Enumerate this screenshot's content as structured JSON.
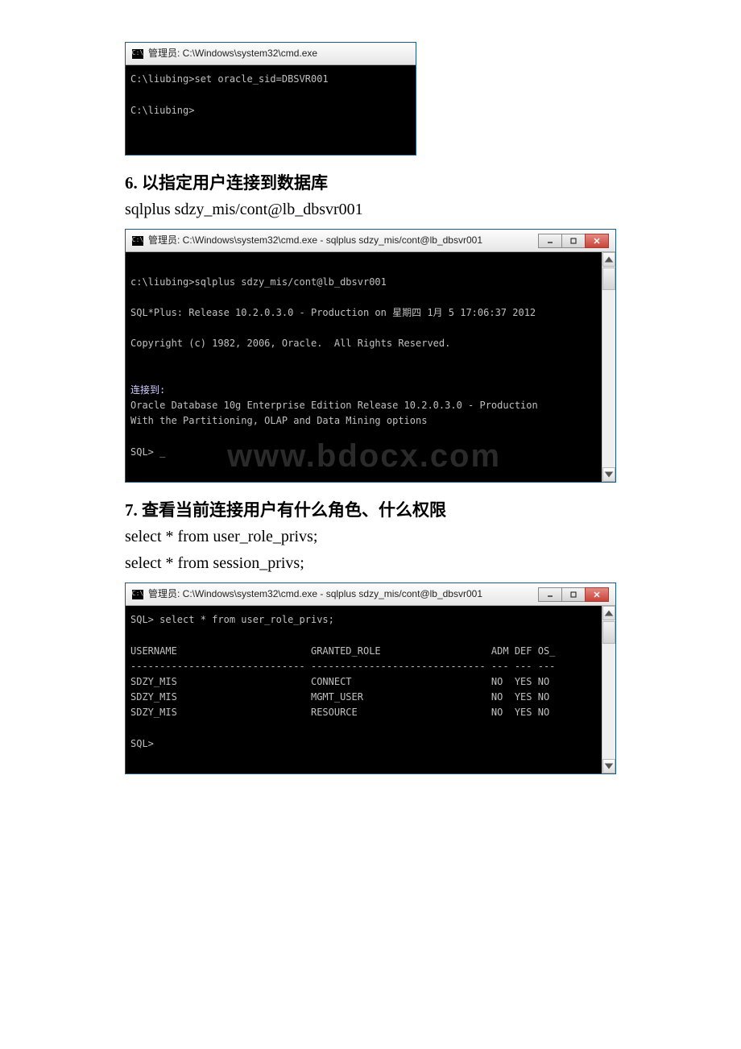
{
  "term1": {
    "title": "管理员: C:\\Windows\\system32\\cmd.exe",
    "l1": "C:\\liubing>set oracle_sid=DBSVR001",
    "l2": " ",
    "l3": "C:\\liubing>",
    "l4": " "
  },
  "h6": {
    "num": "6.",
    "txt": " 以指定用户连接到数据库"
  },
  "cmd6": "sqlplus sdzy_mis/cont@lb_dbsvr001",
  "term2": {
    "title": "管理员: C:\\Windows\\system32\\cmd.exe - sqlplus  sdzy_mis/cont@lb_dbsvr001",
    "l1": " ",
    "l2": "c:\\liubing>sqlplus sdzy_mis/cont@lb_dbsvr001",
    "l3": " ",
    "l4": "SQL*Plus: Release 10.2.0.3.0 - Production on 星期四 1月 5 17:06:37 2012",
    "l5": " ",
    "l6": "Copyright (c) 1982, 2006, Oracle.  All Rights Reserved.",
    "l7": " ",
    "l8": " ",
    "l9": "连接到:",
    "l10": "Oracle Database 10g Enterprise Edition Release 10.2.0.3.0 - Production",
    "l11": "With the Partitioning, OLAP and Data Mining options",
    "l12": " ",
    "l13": "SQL> _",
    "l14": " "
  },
  "watermark": "www.bdocx.com",
  "h7": {
    "num": "7.",
    "txt": " 查看当前连接用户有什么角色、什么权限"
  },
  "cmd7a": "select * from user_role_privs;",
  "cmd7b": "select * from session_privs;",
  "term3": {
    "title": "管理员: C:\\Windows\\system32\\cmd.exe - sqlplus  sdzy_mis/cont@lb_dbsvr001",
    "l1": "SQL> select * from user_role_privs;",
    "l2": " ",
    "l3": "USERNAME                       GRANTED_ROLE                   ADM DEF OS_",
    "l4": "------------------------------ ------------------------------ --- --- ---",
    "l5": "SDZY_MIS                       CONNECT                        NO  YES NO",
    "l6": "SDZY_MIS                       MGMT_USER                      NO  YES NO",
    "l7": "SDZY_MIS                       RESOURCE                       NO  YES NO",
    "l8": " ",
    "l9": "SQL>",
    "l10": " "
  }
}
